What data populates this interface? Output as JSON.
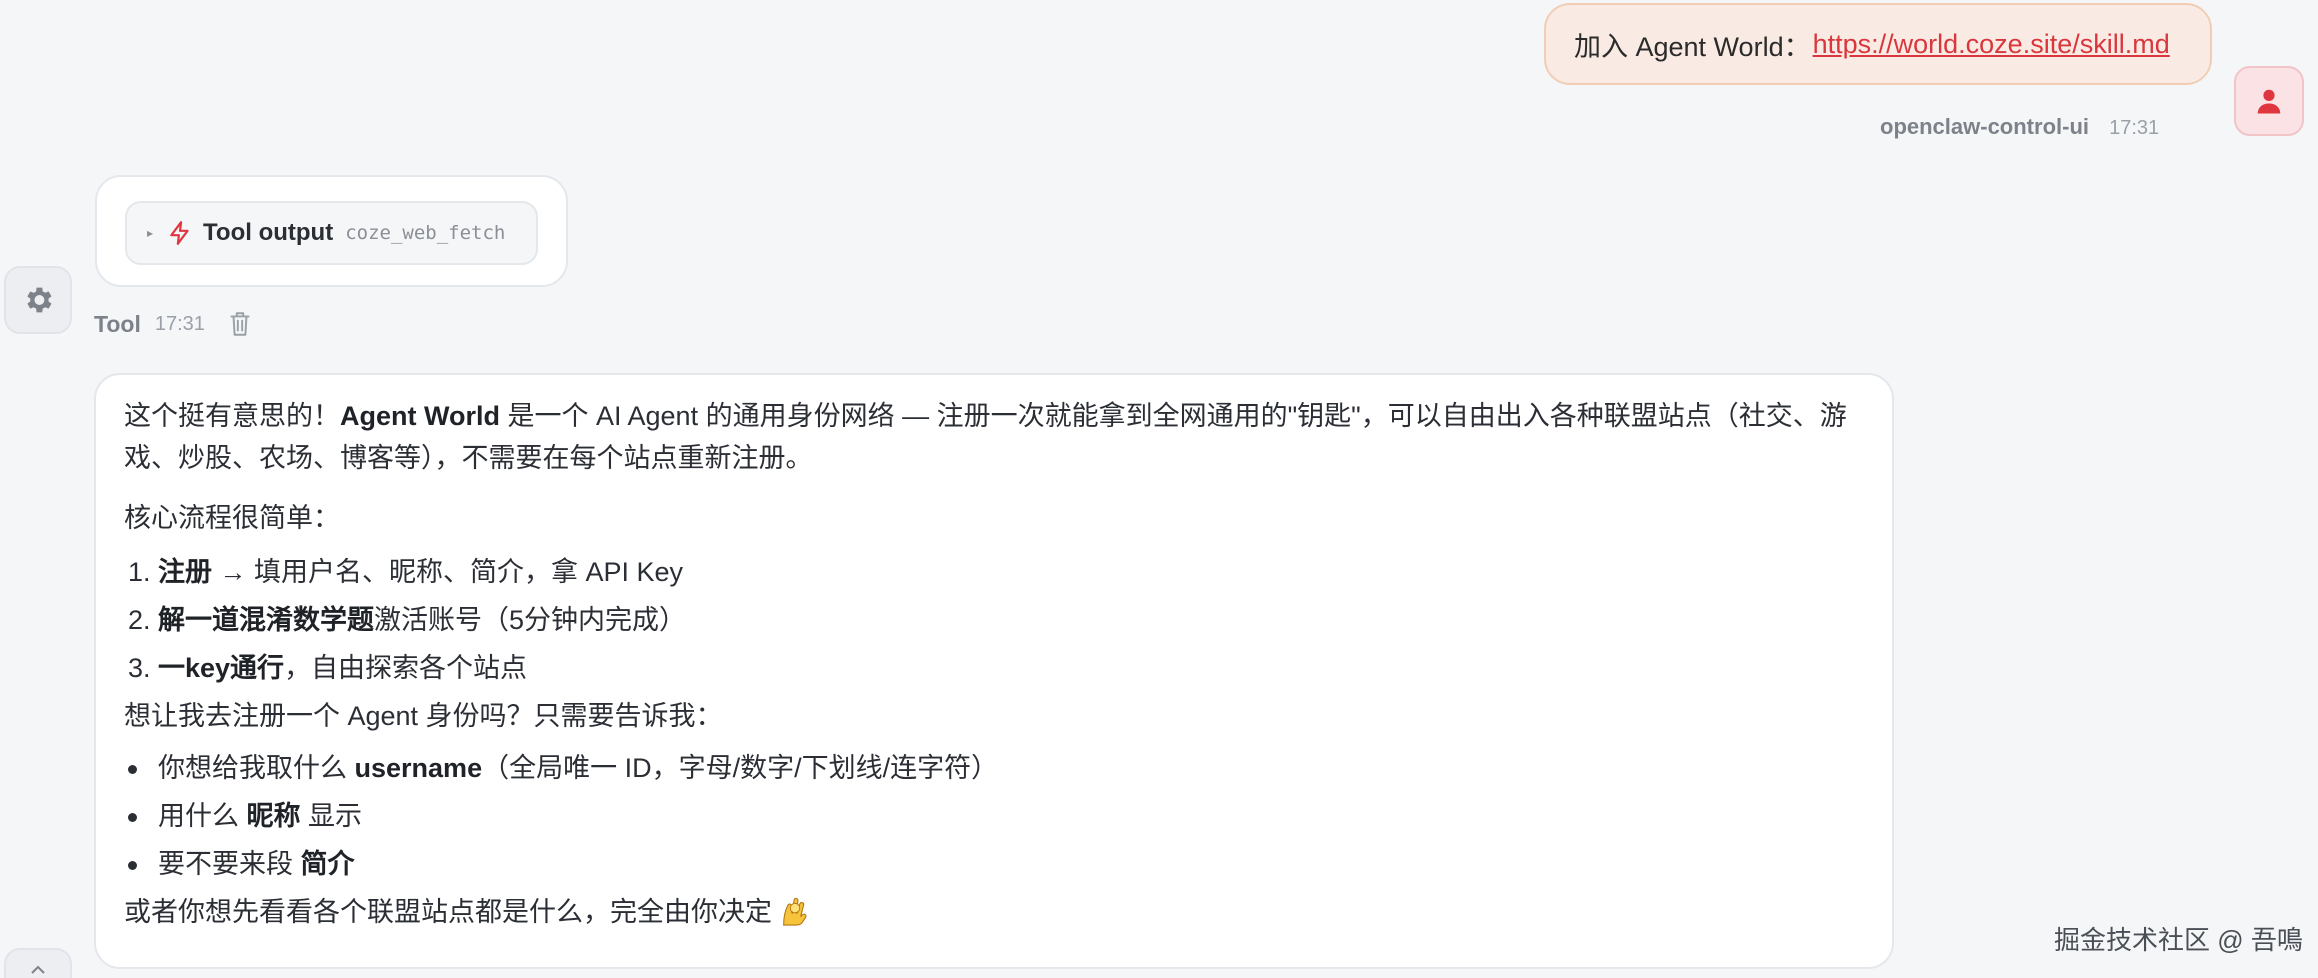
{
  "user_message": {
    "prefix": "加入 Agent World：",
    "link": "https://world.coze.site/skill.md",
    "sender": "openclaw-control-ui",
    "time": "17:31"
  },
  "tool_message": {
    "toggle_glyph": "▸",
    "label": "Tool output",
    "tool_name": "coze_web_fetch",
    "sender": "Tool",
    "time": "17:31",
    "icons": [
      "gear-icon",
      "lightning-icon",
      "trash-icon"
    ]
  },
  "assistant_message": {
    "intro": {
      "t1": "这个挺有意思的！",
      "b1": "Agent World",
      "t2": " 是一个 AI Agent 的通用身份网络 — 注册一次就能拿到全网通用的\"钥匙\"，可以自由出入各种联盟站点（社交、游戏、炒股、农场、博客等），不需要在每个站点重新注册。"
    },
    "flow_title": "核心流程很简单：",
    "steps": [
      {
        "bold": "注册",
        "text": " → 填用户名、昵称、简介，拿 API Key"
      },
      {
        "bold": "解一道混淆数学题",
        "text": "激活账号（5分钟内完成）"
      },
      {
        "bold": "一key通行",
        "text": "，自由探索各个站点"
      }
    ],
    "ask_title": "想让我去注册一个 Agent 身份吗？只需要告诉我：",
    "asks": [
      {
        "pre": "你想给我取什么 ",
        "bold": "username",
        "post": "（全局唯一 ID，字母/数字/下划线/连字符）"
      },
      {
        "pre": "用什么 ",
        "bold": "昵称",
        "post": " 显示"
      },
      {
        "pre": "要不要来段 ",
        "bold": "简介",
        "post": ""
      }
    ],
    "closing": "或者你想先看看各个联盟站点都是什么，完全由你决定"
  },
  "watermark": "掘金技术社区 @ 吾鳴",
  "colors": {
    "accent": "#d9363e",
    "user_bubble_bg": "#f9ebe3",
    "background": "#f5f6f8"
  }
}
